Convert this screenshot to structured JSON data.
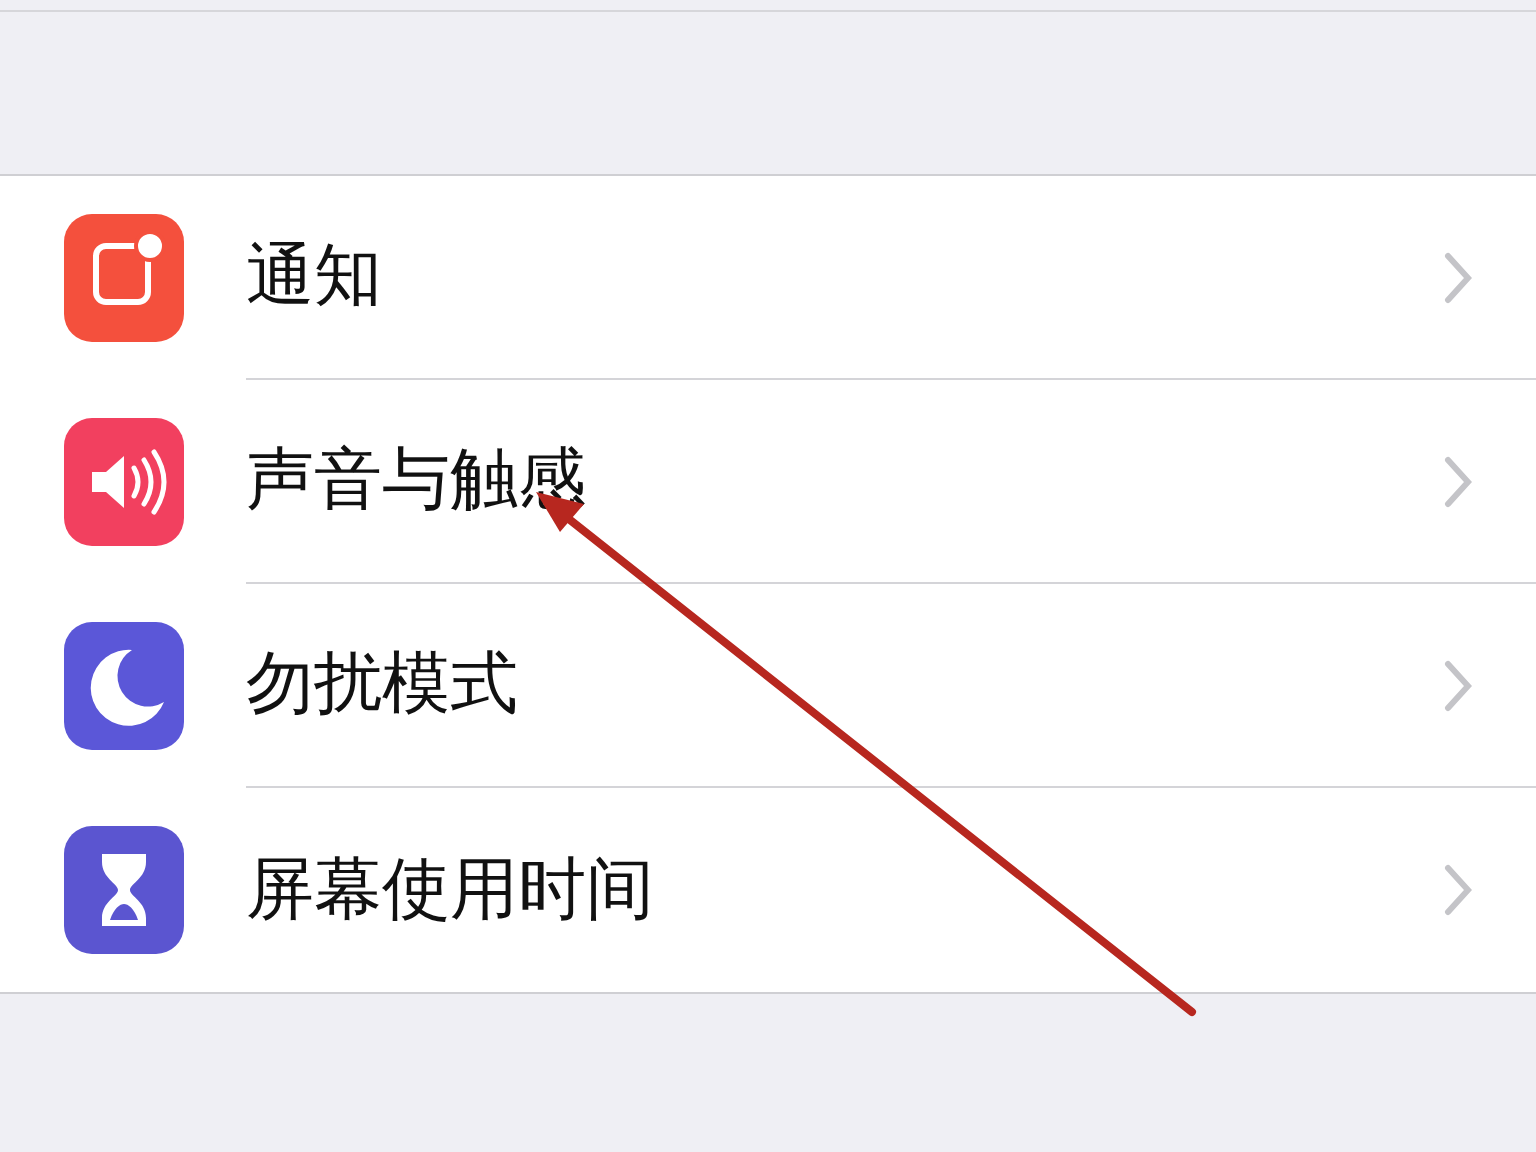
{
  "settings_rows": [
    {
      "label": "通知",
      "kind": "notifications",
      "color": "#f4503d"
    },
    {
      "label": "声音与触感",
      "kind": "sounds",
      "color": "#f2405f"
    },
    {
      "label": "勿扰模式",
      "kind": "focus",
      "color": "#5b57d8"
    },
    {
      "label": "屏幕使用时间",
      "kind": "screentime",
      "color": "#5b55d0"
    }
  ]
}
